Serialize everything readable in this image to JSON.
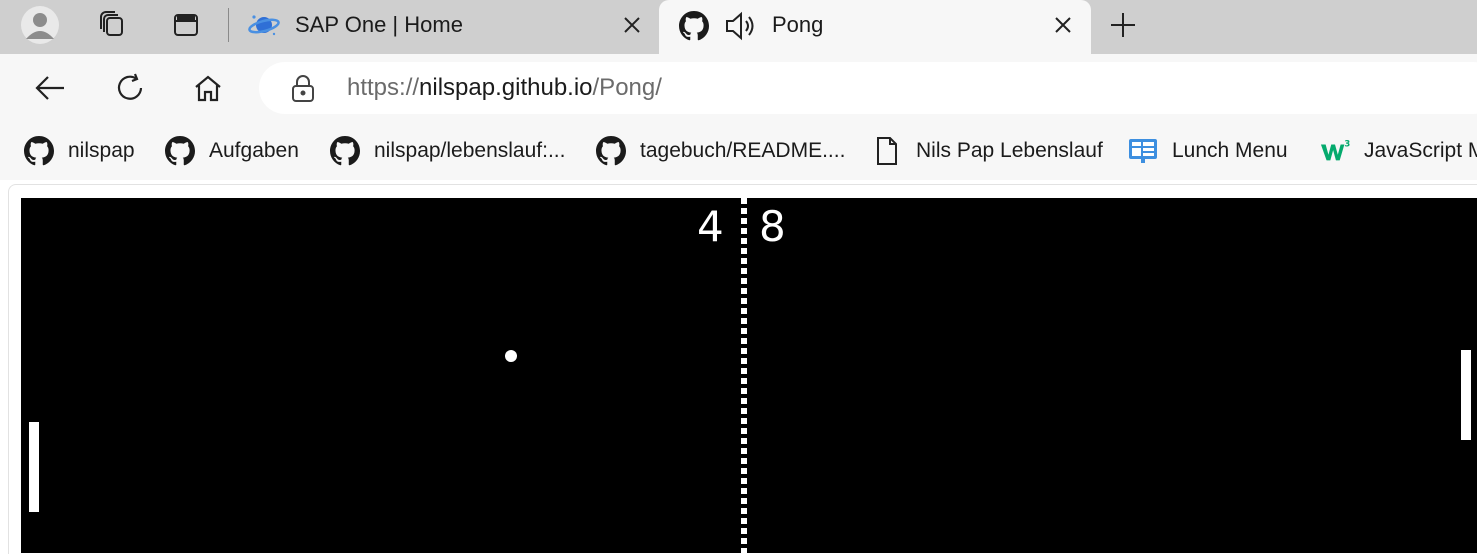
{
  "tabs": [
    {
      "title": "SAP One | Home",
      "icon": "sap-planet-icon",
      "active": false
    },
    {
      "title": "Pong",
      "icon": "github-icon",
      "audio_icon": "speaker-icon",
      "active": true
    }
  ],
  "address": {
    "url_prefix": "https://",
    "url_domain": "nilspap.github.io",
    "url_path": "/Pong/"
  },
  "favorites": [
    {
      "label": "nilspap",
      "icon": "github-icon"
    },
    {
      "label": "Aufgaben",
      "icon": "github-icon"
    },
    {
      "label": "nilspap/lebenslauf:...",
      "icon": "github-icon"
    },
    {
      "label": "tagebuch/README....",
      "icon": "github-icon"
    },
    {
      "label": "Nils Pap Lebenslauf",
      "icon": "document-icon"
    },
    {
      "label": "Lunch Menu",
      "icon": "lunch-menu-icon"
    },
    {
      "label": "JavaScript M",
      "icon": "w3schools-icon"
    }
  ],
  "game": {
    "score_left": "4",
    "score_right": "8"
  }
}
